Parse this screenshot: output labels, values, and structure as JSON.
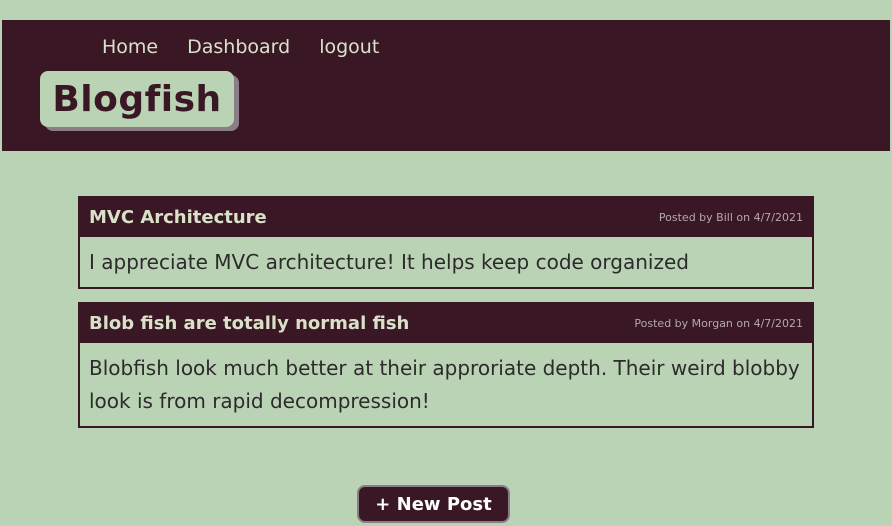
{
  "nav": {
    "items": [
      {
        "label": "Home"
      },
      {
        "label": "Dashboard"
      },
      {
        "label": "logout"
      }
    ]
  },
  "brand": {
    "title": "Blogfish"
  },
  "posts": [
    {
      "title": "MVC Architecture",
      "meta": "Posted by Bill on 4/7/2021",
      "body": "I appreciate MVC architecture! It helps keep code organized"
    },
    {
      "title": "Blob fish are totally normal fish",
      "meta": "Posted by Morgan on 4/7/2021",
      "body": "Blobfish look much better at their approriate depth. Their weird blobby look is from rapid decompression!"
    }
  ],
  "actions": {
    "new_post_label": "+ New Post"
  },
  "colors": {
    "background": "#bad3b5",
    "header": "#3a1725",
    "nav_text": "#d9e2c8",
    "meta_text": "#b3a9ae"
  }
}
